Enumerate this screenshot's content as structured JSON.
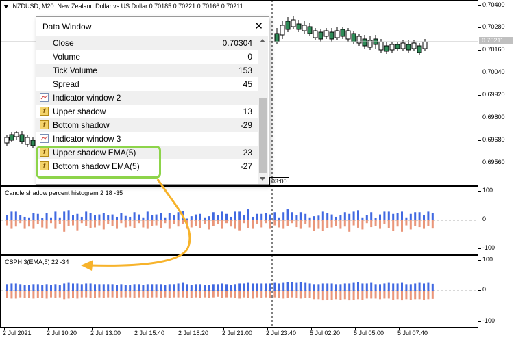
{
  "header": {
    "symbol": "NZDUSD, M20:",
    "description": "New Zealand Dollar vs US Dollar",
    "ohlc": "0.70185 0.70221 0.70166 0.70211"
  },
  "price_axis": {
    "labels": [
      "0.70400",
      "0.70280",
      "0.70160",
      "0.70040",
      "0.69920",
      "0.69800",
      "0.69680",
      "0.69560"
    ],
    "current": "0.70211"
  },
  "pane2": {
    "title": "Candle shadow percent histogram 2 18 -35",
    "levels": [
      "100",
      "0",
      "-100"
    ]
  },
  "pane3": {
    "title": "CSPH 3(EMA,5) 22 -34",
    "levels": [
      "100",
      "0",
      "-100"
    ]
  },
  "time_axis": [
    "2 Jul 2021",
    "2 Jul 10:20",
    "2 Jul 13:00",
    "2 Jul 15:40",
    "2 Jul 18:20",
    "2 Jul 21:00",
    "2 Jul 23:40",
    "5 Jul 02:20",
    "5 Jul 05:00",
    "5 Jul 07:40"
  ],
  "crosshair_time": "03:00",
  "data_window": {
    "title": "Data Window",
    "close_symbol": "✕",
    "rows": [
      {
        "name": "Close",
        "value": "0.70304",
        "icon": "none"
      },
      {
        "name": "Volume",
        "value": "0",
        "icon": "none"
      },
      {
        "name": "Tick Volume",
        "value": "153",
        "icon": "none"
      },
      {
        "name": "Spread",
        "value": "45",
        "icon": "none"
      },
      {
        "name": "Indicator window 2",
        "value": "",
        "icon": "indicator"
      },
      {
        "name": "Upper shadow",
        "value": "13",
        "icon": "f"
      },
      {
        "name": "Bottom shadow",
        "value": "-29",
        "icon": "f"
      },
      {
        "name": "Indicator window 3",
        "value": "",
        "icon": "indicator"
      },
      {
        "name": "Upper shadow EMA(5)",
        "value": "23",
        "icon": "f"
      },
      {
        "name": "Bottom shadow EMA(5)",
        "value": "-27",
        "icon": "f"
      }
    ]
  },
  "colors": {
    "up_bar": "#4169e1",
    "down_bar": "#e9967a",
    "candle_up": "#ffffff",
    "candle_down": "#2e8b57",
    "annotation": "#f7b32b",
    "highlight": "#8dd44a"
  },
  "chart_data": [
    {
      "type": "bar",
      "title": "Candle shadow percent histogram 2 18 -35",
      "ylim": [
        -100,
        100
      ],
      "series": [
        {
          "name": "Upper shadow",
          "values": [
            18,
            30,
            30,
            18,
            12,
            10,
            25,
            22,
            8,
            25,
            10,
            30,
            10,
            30,
            35,
            18,
            22,
            12,
            30,
            25,
            18,
            20,
            25,
            18,
            20,
            12,
            25,
            15,
            12,
            28,
            20,
            10,
            30,
            18,
            20,
            26,
            10,
            24,
            18,
            28,
            32,
            6,
            14,
            20,
            22,
            10,
            14,
            28,
            18,
            30,
            22,
            12,
            30,
            30,
            18,
            38,
            12,
            22,
            22,
            25,
            20,
            28,
            10,
            28,
            38,
            28,
            18,
            28,
            22,
            10,
            14,
            16,
            30,
            25,
            20,
            12,
            18,
            28,
            22,
            30,
            35,
            10,
            18,
            28,
            8,
            20,
            30,
            30,
            22,
            25,
            30,
            10,
            22,
            28,
            28,
            18,
            30,
            25
          ]
        },
        {
          "name": "Bottom shadow",
          "values": [
            -18,
            -30,
            -22,
            -10,
            -30,
            -22,
            -30,
            -12,
            -25,
            -30,
            -10,
            -30,
            -12,
            -40,
            -20,
            -18,
            -35,
            -10,
            -20,
            -28,
            -25,
            -18,
            -32,
            -12,
            -20,
            -30,
            -10,
            -25,
            -22,
            -28,
            -10,
            -25,
            -30,
            -20,
            -18,
            -28,
            -10,
            -30,
            -12,
            -22,
            -12,
            -30,
            -25,
            -20,
            -28,
            -12,
            -32,
            -20,
            -12,
            -30,
            -10,
            -22,
            -30,
            -35,
            -10,
            -28,
            -30,
            -12,
            -25,
            -10,
            -30,
            -18,
            -25,
            -30,
            -20,
            -10,
            -24,
            -30,
            -12,
            -25,
            -36,
            -30,
            -38,
            -28,
            -25,
            -20,
            -30,
            -22,
            -40,
            -18,
            -26,
            -32,
            -10,
            -24,
            -20,
            -30,
            -14,
            -28,
            -36,
            -22,
            -40,
            -18,
            -32,
            -20,
            -24,
            -30,
            -20,
            -29
          ]
        }
      ]
    },
    {
      "type": "bar",
      "title": "CSPH 3(EMA,5) 22 -34",
      "ylim": [
        -100,
        100
      ],
      "series": [
        {
          "name": "Upper shadow EMA(5)",
          "values": [
            22,
            24,
            24,
            22,
            20,
            20,
            22,
            22,
            20,
            22,
            20,
            22,
            20,
            24,
            26,
            24,
            24,
            22,
            24,
            24,
            22,
            22,
            22,
            22,
            22,
            20,
            22,
            20,
            20,
            22,
            22,
            20,
            22,
            22,
            22,
            22,
            20,
            22,
            22,
            24,
            26,
            22,
            20,
            22,
            22,
            20,
            20,
            22,
            22,
            24,
            22,
            20,
            22,
            24,
            24,
            26,
            24,
            24,
            24,
            24,
            24,
            26,
            24,
            26,
            28,
            28,
            26,
            28,
            26,
            24,
            22,
            22,
            24,
            24,
            24,
            22,
            22,
            24,
            24,
            26,
            28,
            24,
            24,
            26,
            22,
            22,
            24,
            26,
            24,
            24,
            26,
            22,
            22,
            24,
            26,
            24,
            26,
            23
          ]
        },
        {
          "name": "Bottom shadow EMA(5)",
          "values": [
            -24,
            -26,
            -26,
            -22,
            -24,
            -24,
            -26,
            -24,
            -24,
            -26,
            -22,
            -24,
            -22,
            -28,
            -26,
            -24,
            -26,
            -22,
            -22,
            -24,
            -24,
            -22,
            -24,
            -22,
            -22,
            -24,
            -22,
            -22,
            -22,
            -24,
            -22,
            -22,
            -24,
            -22,
            -22,
            -24,
            -22,
            -24,
            -22,
            -22,
            -22,
            -24,
            -24,
            -22,
            -24,
            -22,
            -24,
            -22,
            -20,
            -24,
            -22,
            -22,
            -24,
            -26,
            -22,
            -24,
            -26,
            -22,
            -24,
            -22,
            -24,
            -22,
            -24,
            -26,
            -24,
            -22,
            -24,
            -26,
            -24,
            -24,
            -28,
            -28,
            -32,
            -30,
            -30,
            -28,
            -30,
            -28,
            -32,
            -30,
            -28,
            -30,
            -26,
            -26,
            -26,
            -28,
            -26,
            -26,
            -30,
            -28,
            -32,
            -28,
            -30,
            -28,
            -28,
            -30,
            -28,
            -27
          ]
        }
      ]
    }
  ]
}
